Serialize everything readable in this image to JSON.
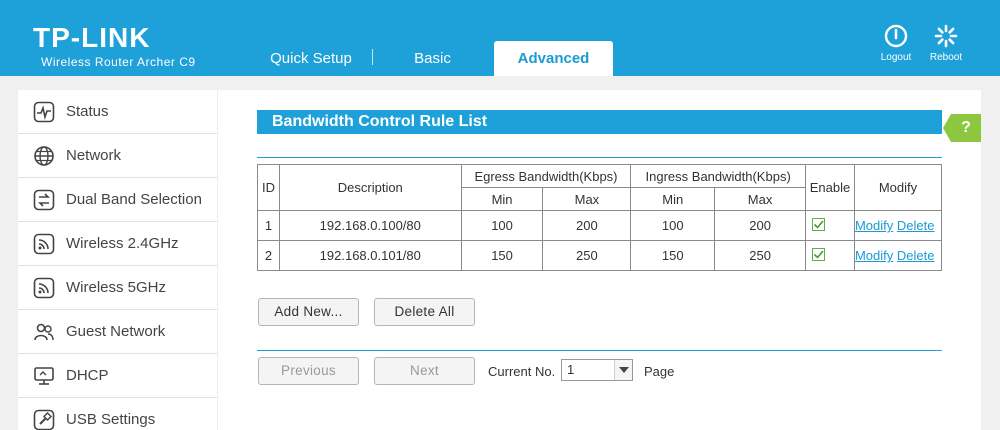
{
  "header": {
    "brand": "TP-LINK",
    "model": "Wireless Router Archer C9",
    "tabs": {
      "quick": "Quick Setup",
      "basic": "Basic",
      "advanced": "Advanced"
    },
    "logout": "Logout",
    "reboot": "Reboot"
  },
  "sidebar": {
    "items": [
      {
        "label": "Status",
        "icon": "status-icon"
      },
      {
        "label": "Network",
        "icon": "globe-icon"
      },
      {
        "label": "Dual Band Selection",
        "icon": "band-switch-icon"
      },
      {
        "label": "Wireless 2.4GHz",
        "icon": "wireless-icon"
      },
      {
        "label": "Wireless 5GHz",
        "icon": "wireless-icon"
      },
      {
        "label": "Guest Network",
        "icon": "guest-icon"
      },
      {
        "label": "DHCP",
        "icon": "monitor-icon"
      },
      {
        "label": "USB Settings",
        "icon": "usb-icon"
      }
    ]
  },
  "help": "?",
  "section": {
    "title": "Bandwidth Control Rule List",
    "columns": {
      "id": "ID",
      "description": "Description",
      "egress": "Egress Bandwidth(Kbps)",
      "ingress": "Ingress Bandwidth(Kbps)",
      "enable": "Enable",
      "modify": "Modify",
      "min": "Min",
      "max": "Max"
    },
    "rows": [
      {
        "id": "1",
        "description": "192.168.0.100/80",
        "egress_min": "100",
        "egress_max": "200",
        "ingress_min": "100",
        "ingress_max": "200",
        "modify": "Modify",
        "delete": "Delete"
      },
      {
        "id": "2",
        "description": "192.168.0.101/80",
        "egress_min": "150",
        "egress_max": "250",
        "ingress_min": "150",
        "ingress_max": "250",
        "modify": "Modify",
        "delete": "Delete"
      }
    ]
  },
  "buttons": {
    "add_new": "Add New...",
    "delete_all": "Delete All",
    "previous": "Previous",
    "next": "Next"
  },
  "pager": {
    "current_label": "Current No.",
    "current_value": "1",
    "page_label": "Page"
  },
  "colors": {
    "accent": "#1ea0d9",
    "help": "#8dc63f",
    "check": "#4a9a2e"
  }
}
